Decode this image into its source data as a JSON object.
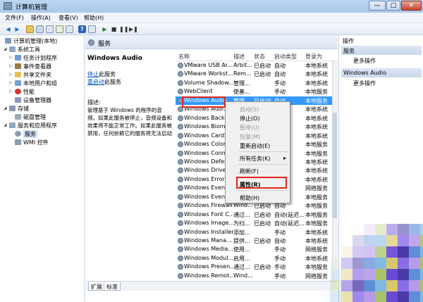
{
  "window": {
    "title": "计算机管理",
    "buttons": [
      "—",
      "□",
      "✕"
    ]
  },
  "menu": [
    "文件(F)",
    "操作(A)",
    "查看(V)",
    "帮助(H)"
  ],
  "tree": [
    {
      "label": "计算机管理(本地)",
      "level": 0
    },
    {
      "label": "系统工具",
      "level": 1
    },
    {
      "label": "任务计划程序",
      "level": 2
    },
    {
      "label": "事件查看器",
      "level": 2
    },
    {
      "label": "共享文件夹",
      "level": 2
    },
    {
      "label": "本地用户和组",
      "level": 2
    },
    {
      "label": "性能",
      "level": 2
    },
    {
      "label": "设备管理器",
      "level": 2
    },
    {
      "label": "存储",
      "level": 1
    },
    {
      "label": "磁盘管理",
      "level": 2
    },
    {
      "label": "服务和应用程序",
      "level": 1
    },
    {
      "label": "服务",
      "level": 2,
      "selected": true
    },
    {
      "label": "WMI 控件",
      "level": 2
    }
  ],
  "header": {
    "title": "服务"
  },
  "details": {
    "service_name": "Windows Audio",
    "stop_link": "停止",
    "stop_suffix": "此服务",
    "restart_link": "重启动",
    "restart_suffix": "此服务",
    "desc_label": "描述:",
    "description": "管理基于 Windows 的程序的音频。如果此服务被停止，音频设备和效果将不能正常工作。如果此服务被禁用，任何依赖它的服务将无法启动"
  },
  "columns": [
    "名称",
    "描述",
    "状态",
    "启动类型",
    "登录为"
  ],
  "rows": [
    [
      "VMware USB Ar...",
      "Arbit...",
      "已启动",
      "自动",
      "本地系统"
    ],
    [
      "VMware Workst...",
      "Rem...",
      "已启动",
      "自动",
      "本地系统"
    ],
    [
      "Volume Shadow...",
      "管理...",
      "",
      "手动",
      "本地系统"
    ],
    [
      "WebClient",
      "使基...",
      "",
      "手动",
      "本地服务"
    ],
    [
      "Windows Audio",
      "管理...",
      "已启动",
      "自动",
      "本地服务"
    ],
    [
      "Windows Audi...",
      "",
      "",
      "",
      "本地系统"
    ],
    [
      "Windows Backu...",
      "",
      "",
      "",
      "本地系统"
    ],
    [
      "Windows Biome...",
      "",
      "",
      "",
      "本地系统"
    ],
    [
      "Windows CardS...",
      "",
      "",
      "",
      "本地系统"
    ],
    [
      "Windows Color ...",
      "",
      "",
      "",
      "本地服务"
    ],
    [
      "Windows Conne...",
      "",
      "",
      "",
      "本地服务"
    ],
    [
      "Windows Defen...",
      "",
      "",
      "",
      "本地系统"
    ],
    [
      "Windows Driver...",
      "",
      "",
      "",
      "本地系统"
    ],
    [
      "Windows Error ...",
      "",
      "",
      "",
      "本地系统"
    ],
    [
      "Windows Event ...",
      "",
      "",
      "",
      "网络服务"
    ],
    [
      "Windows Event ...",
      "",
      "",
      "",
      "本地服务"
    ],
    [
      "Windows Firewall",
      "Wind...",
      "已启动",
      "自动",
      "本地服务"
    ],
    [
      "Windows Font C...",
      "通过...",
      "已启动",
      "自动(延迟...",
      "本地服务"
    ],
    [
      "Windows Image...",
      "为扫...",
      "已启动",
      "自动(延迟...",
      "本地服务"
    ],
    [
      "Windows Installer",
      "添加...",
      "",
      "手动",
      "本地系统"
    ],
    [
      "Windows Mana...",
      "提供...",
      "已启动",
      "自动",
      "本地系统"
    ],
    [
      "Windows Media...",
      "使用...",
      "",
      "手动",
      "网络服务"
    ],
    [
      "Windows Modul...",
      "启用...",
      "",
      "手动",
      "本地系统"
    ],
    [
      "Windows Presen...",
      "通过...",
      "已启动",
      "手动",
      "本地服务"
    ],
    [
      "Windows Remot...",
      "Wind...",
      "",
      "手动",
      "网络服务"
    ]
  ],
  "selected_row_index": 4,
  "tabs": [
    "扩展",
    "标准"
  ],
  "context_menu": [
    {
      "label": "启动(S)",
      "disabled": true
    },
    {
      "label": "停止(O)",
      "disabled": false
    },
    {
      "label": "暂停(U)",
      "disabled": true
    },
    {
      "label": "恢复(M)",
      "disabled": true
    },
    {
      "label": "重新启动(E)",
      "disabled": false
    },
    {
      "label": "所有任务(K)",
      "disabled": false,
      "submenu": "▸"
    },
    {
      "label": "刷新(F)",
      "disabled": false
    },
    {
      "label": "属性(R)",
      "disabled": false,
      "bold": true
    },
    {
      "label": "帮助(H)",
      "disabled": false
    }
  ],
  "actions": {
    "section1": "操作",
    "group1": "服务",
    "more1": "更多操作",
    "group2": "Windows Audio",
    "more2": "更多操作"
  },
  "colors": {
    "selection": "#3399ff",
    "highlight_border": "#e0261c",
    "link": "#0a55c7"
  }
}
